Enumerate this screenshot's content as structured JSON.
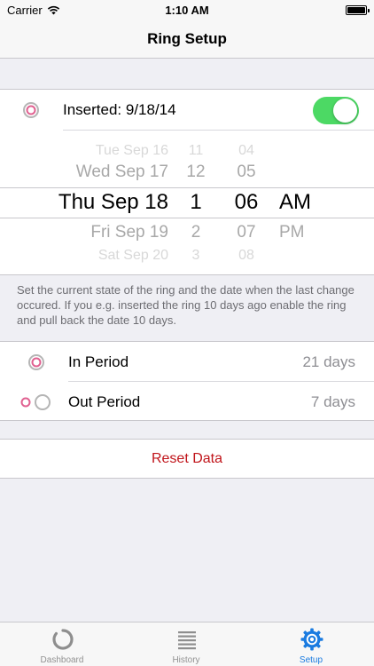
{
  "status": {
    "carrier": "Carrier",
    "time": "1:10 AM"
  },
  "nav": {
    "title": "Ring Setup"
  },
  "inserted": {
    "label": "Inserted: 9/18/14",
    "toggle_on": true
  },
  "picker": {
    "rows": [
      {
        "date": "Tue Sep 16",
        "hour": "11",
        "minute": "04",
        "ampm": ""
      },
      {
        "date": "Wed Sep 17",
        "hour": "12",
        "minute": "05",
        "ampm": ""
      },
      {
        "date": "Thu Sep 18",
        "hour": "1",
        "minute": "06",
        "ampm": "AM"
      },
      {
        "date": "Fri Sep 19",
        "hour": "2",
        "minute": "07",
        "ampm": "PM"
      },
      {
        "date": "Sat Sep 20",
        "hour": "3",
        "minute": "08",
        "ampm": ""
      }
    ]
  },
  "note": "Set the current state of the ring and the date when the last change occured. If you e.g. inserted the ring 10 days ago enable the ring and pull back the date 10 days.",
  "periods": [
    {
      "label": "In Period",
      "value": "21 days"
    },
    {
      "label": "Out Period",
      "value": "7 days"
    }
  ],
  "reset": {
    "label": "Reset Data"
  },
  "tabs": [
    {
      "label": "Dashboard",
      "icon": "spinner-icon",
      "active": false
    },
    {
      "label": "History",
      "icon": "list-icon",
      "active": false
    },
    {
      "label": "Setup",
      "icon": "gear-icon",
      "active": true
    }
  ],
  "colors": {
    "accent": "#1a7be0",
    "toggle": "#4cd964",
    "ring": "#e06090",
    "reset": "#c0141a"
  }
}
